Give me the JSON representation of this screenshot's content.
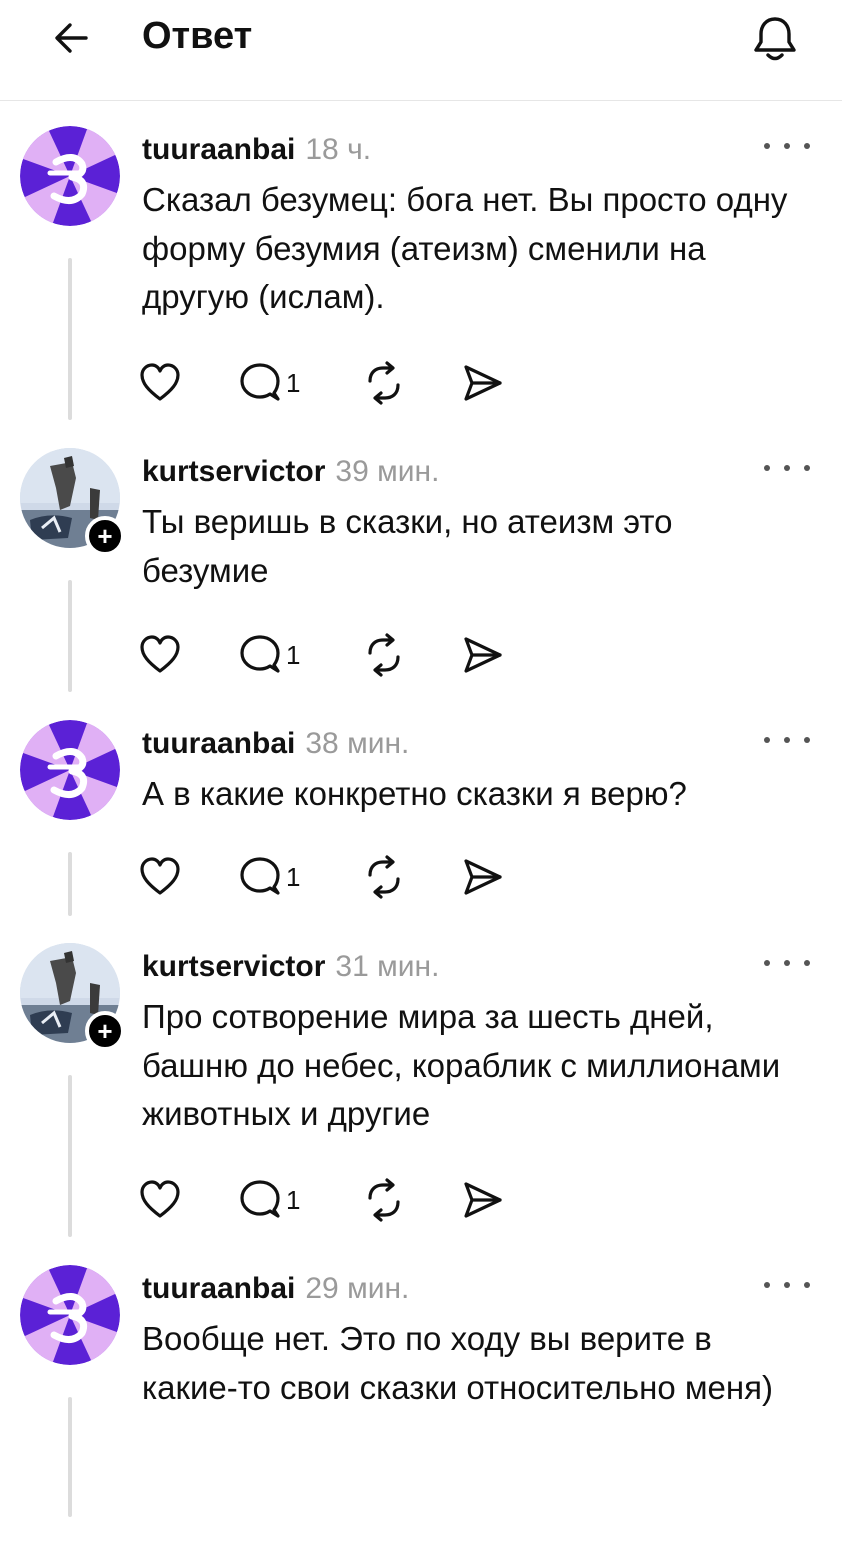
{
  "header": {
    "title": "Ответ",
    "back_icon": "arrow-left-icon",
    "bell_icon": "bell-icon"
  },
  "colors": {
    "accent_avatar_purple": "#5b21d6",
    "accent_avatar_pink": "#e0b0f5",
    "time_gray": "#9a9a9a",
    "thread_line": "#dcdcdc"
  },
  "posts": [
    {
      "username": "tuuraanbai",
      "time": "18 ч.",
      "text": "Сказал безумец: бога нет. Вы просто одну форму безумия (атеизм) сменили на другую (ислам).",
      "reply_count": "1",
      "has_follow_badge": false
    },
    {
      "username": "kurtservictor",
      "time": "39 мин.",
      "text": "Ты веришь в сказки, но атеизм это безумие",
      "reply_count": "1",
      "has_follow_badge": true,
      "follow_badge": "+"
    },
    {
      "username": "tuuraanbai",
      "time": "38 мин.",
      "text": "А в какие конкретно сказки я верю?",
      "reply_count": "1",
      "has_follow_badge": false
    },
    {
      "username": "kurtservictor",
      "time": "31 мин.",
      "text": "Про сотворение мира за шесть дней, башню до небес, кораблик с миллионами животных и другие",
      "reply_count": "1",
      "has_follow_badge": true,
      "follow_badge": "+"
    },
    {
      "username": "tuuraanbai",
      "time": "29 мин.",
      "text": "Вообще нет. Это по ходу вы верите в какие-то свои сказки относительно меня)",
      "has_follow_badge": false
    }
  ]
}
